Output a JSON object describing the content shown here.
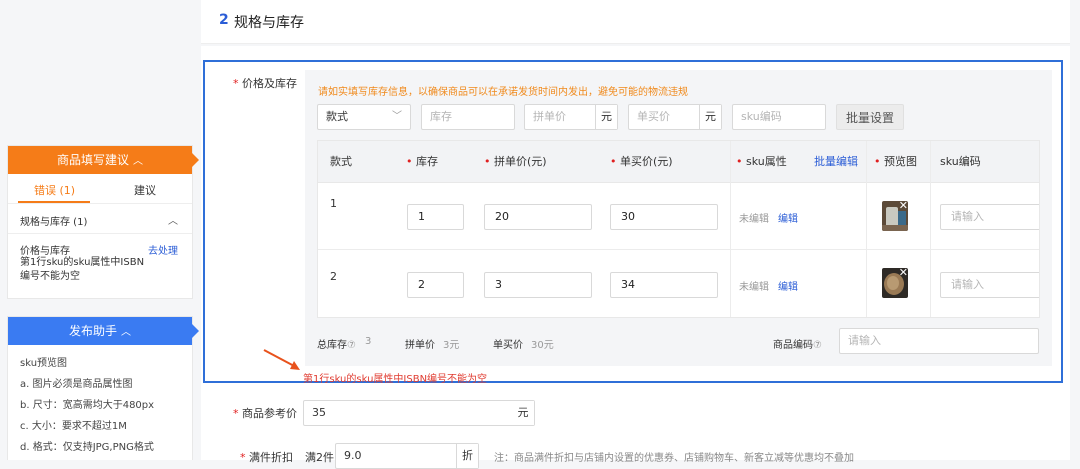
{
  "section": {
    "number": "2",
    "title": "规格与库存"
  },
  "suggest_panel": {
    "title": "商品填写建议",
    "tabs": [
      {
        "label": "错误 (1)",
        "active": true
      },
      {
        "label": "建议",
        "active": false
      }
    ],
    "group_label": "规格与库存 (1)",
    "item_label": "价格与库存",
    "item_action": "去处理",
    "item_desc": "第1行sku的sku属性中ISBN编号不能为空"
  },
  "publish_panel": {
    "title": "发布助手",
    "lines": [
      "sku预览图",
      "a. 图片必须是商品属性图",
      "b. 尺寸：宽高需均大于480px",
      "c. 大小：要求不超过1M",
      "d. 格式：仅支持JPG,PNG格式"
    ]
  },
  "price_stock": {
    "label": "价格及库存",
    "notice": "请如实填写库存信息，以确保商品可以在承诺发货时间内发出，避免可能的物流违规",
    "batch_bar": {
      "style_select": "款式",
      "stock_placeholder": "库存",
      "group_price_placeholder": "拼单价",
      "group_price_unit": "元",
      "single_price_placeholder": "单买价",
      "single_price_unit": "元",
      "sku_code_placeholder": "sku编码",
      "batch_button": "批量设置"
    },
    "table": {
      "headers": {
        "style": "款式",
        "stock": "库存",
        "group_price": "拼单价(元)",
        "single_price": "单买价(元)",
        "sku_attr": "sku属性",
        "batch_edit": "批量编辑",
        "preview": "预览图",
        "sku_code": "sku编码"
      },
      "rows": [
        {
          "index": "1",
          "stock": "1",
          "group_price": "20",
          "single_price": "30",
          "attr_status": "未编辑",
          "edit": "编辑",
          "sku_placeholder": "请输入",
          "thumb_color": "#6e5a45"
        },
        {
          "index": "2",
          "stock": "2",
          "group_price": "3",
          "single_price": "34",
          "attr_status": "未编辑",
          "edit": "编辑",
          "sku_placeholder": "请输入",
          "thumb_color": "#8a6a4a"
        }
      ]
    },
    "footer": {
      "total_stock_label": "总库存",
      "total_stock_value": "3",
      "group_price_label": "拼单价",
      "group_price_value": "3元",
      "single_price_label": "单买价",
      "single_price_value": "30元",
      "product_code_label": "商品编码",
      "product_code_placeholder": "请输入"
    },
    "error": "第1行sku的sku属性中ISBN编号不能为空"
  },
  "reference_price": {
    "label": "商品参考价",
    "value": "35",
    "unit": "元"
  },
  "full_discount": {
    "label": "满件折扣",
    "prefix": "满2件",
    "value": "9.0",
    "unit": "折",
    "note": "注：商品满件折扣与店铺内设置的优惠券、店铺购物车、新客立减等优惠均不叠加"
  },
  "colors": {
    "orange": "#f57c18",
    "blue": "#3a7bf2",
    "highlight_border": "#2f6fd8",
    "error": "#e03c31"
  }
}
